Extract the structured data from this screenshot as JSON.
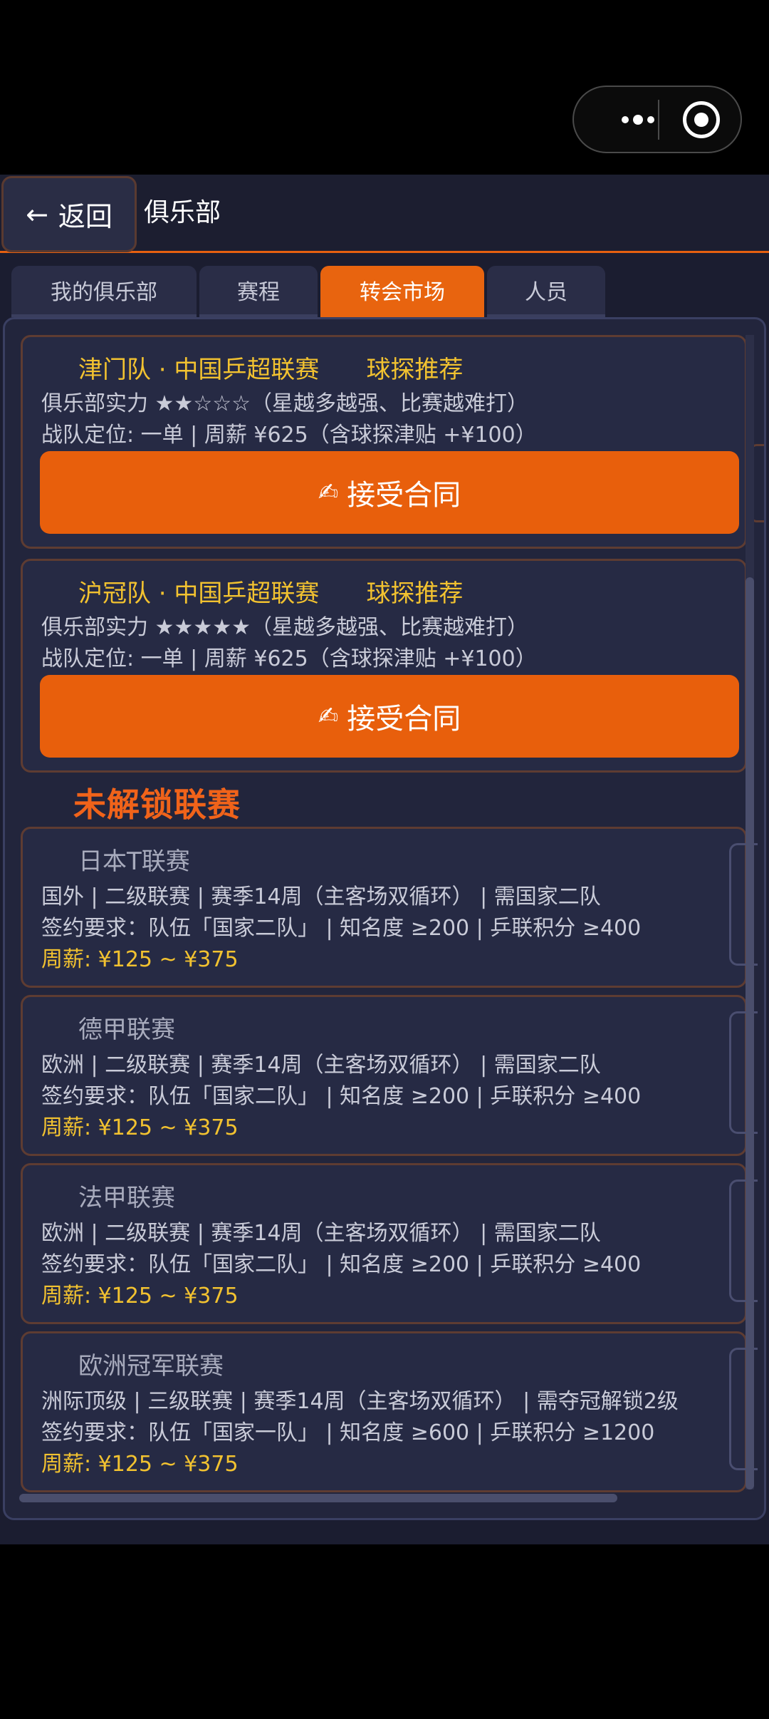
{
  "colors": {
    "accent": "#e8640f",
    "gold": "#f2c230",
    "bg": "#1b1d30",
    "card": "#262a44"
  },
  "header": {
    "back_label": "返回",
    "back_icon": "←",
    "title": "俱乐部"
  },
  "tabs": [
    {
      "label": "我的俱乐部",
      "active": false
    },
    {
      "label": "赛程",
      "active": false
    },
    {
      "label": "转会市场",
      "active": true
    },
    {
      "label": "人员",
      "active": false
    }
  ],
  "offers": [
    {
      "team": "津门队 · 中国乒超联赛",
      "tag": "球探推荐",
      "strength": "俱乐部实力 ★★☆☆☆（星越多越强、比赛越难打）",
      "position": "战队定位: 一单 | 周薪 ¥625（含球探津贴 +¥100）",
      "button_icon": "✍",
      "button_label": "接受合同"
    },
    {
      "team": "沪冠队 · 中国乒超联赛",
      "tag": "球探推荐",
      "strength": "俱乐部实力 ★★★★★（星越多越强、比赛越难打）",
      "position": "战队定位: 一单 | 周薪 ¥625（含球探津贴 +¥100）",
      "button_icon": "✍",
      "button_label": "接受合同"
    }
  ],
  "locked_section_title": "未解锁联赛",
  "leagues": [
    {
      "name": "日本T联赛",
      "info": "国外 | 二级联赛 | 赛季14周（主客场双循环） | 需国家二队",
      "requirement": "签约要求：队伍「国家二队」 | 知名度 ≥200 | 乒联积分 ≥400",
      "salary": "周薪: ¥125 ~ ¥375"
    },
    {
      "name": "德甲联赛",
      "info": "欧洲 | 二级联赛 | 赛季14周（主客场双循环） | 需国家二队",
      "requirement": "签约要求：队伍「国家二队」 | 知名度 ≥200 | 乒联积分 ≥400",
      "salary": "周薪: ¥125 ~ ¥375"
    },
    {
      "name": "法甲联赛",
      "info": "欧洲 | 二级联赛 | 赛季14周（主客场双循环） | 需国家二队",
      "requirement": "签约要求：队伍「国家二队」 | 知名度 ≥200 | 乒联积分 ≥400",
      "salary": "周薪: ¥125 ~ ¥375"
    },
    {
      "name": "欧洲冠军联赛",
      "info": "洲际顶级 | 三级联赛 | 赛季14周（主客场双循环） | 需夺冠解锁2级",
      "requirement": "签约要求：队伍「国家一队」 | 知名度 ≥600 | 乒联积分 ≥1200",
      "salary": "周薪: ¥125 ~ ¥375"
    }
  ]
}
